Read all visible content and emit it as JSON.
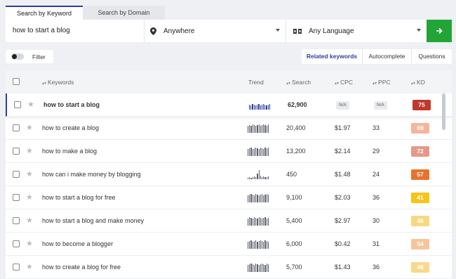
{
  "tabs": {
    "keyword": "Search by Keyword",
    "domain": "Search by Domain"
  },
  "search": {
    "query": "how to start a blog",
    "location": "Anywhere",
    "language": "Any Language"
  },
  "filter": {
    "label": "Filter"
  },
  "modes": {
    "related": "Related keywords",
    "autocomplete": "Autocomplete",
    "questions": "Questions"
  },
  "headers": {
    "keywords": "Keywords",
    "trend": "Trend",
    "search": "Search",
    "cpc": "CPC",
    "ppc": "PPC",
    "kd": "KD"
  },
  "rows": [
    {
      "keyword": "how to start a blog",
      "search": "62,900",
      "cpc": "N/A",
      "ppc": "N/A",
      "kd": "75",
      "kd_color": "#c0392b",
      "trend": [
        7,
        6,
        8,
        7,
        6,
        7,
        8,
        6,
        7,
        8,
        7,
        6,
        7,
        8
      ]
    },
    {
      "keyword": "how to create a blog",
      "search": "20,400",
      "cpc": "$1.97",
      "ppc": "33",
      "kd": "69",
      "kd_color": "#f4b69a",
      "trend": [
        10,
        11,
        10,
        12,
        11,
        10,
        11,
        12,
        10,
        11,
        12,
        11,
        10,
        12
      ]
    },
    {
      "keyword": "how to make a blog",
      "search": "13,200",
      "cpc": "$2.14",
      "ppc": "29",
      "kd": "72",
      "kd_color": "#e59a89",
      "trend": [
        10,
        11,
        12,
        10,
        11,
        12,
        11,
        10,
        12,
        11,
        10,
        12,
        11,
        12
      ]
    },
    {
      "keyword": "how can i make money by blogging",
      "search": "450",
      "cpc": "$1.48",
      "ppc": "24",
      "kd": "57",
      "kd_color": "#e8732e",
      "trend": [
        2,
        3,
        2,
        3,
        4,
        3,
        8,
        13,
        5,
        3,
        4,
        3,
        3,
        4
      ]
    },
    {
      "keyword": "how to start a blog for free",
      "search": "9,100",
      "cpc": "$2.03",
      "ppc": "36",
      "kd": "41",
      "kd_color": "#f5c518",
      "trend": [
        10,
        11,
        12,
        11,
        10,
        12,
        11,
        10,
        11,
        12,
        10,
        11,
        12,
        11
      ]
    },
    {
      "keyword": "how to start a blog and make money",
      "search": "5,400",
      "cpc": "$2.97",
      "ppc": "30",
      "kd": "46",
      "kd_color": "#f8d87f",
      "trend": [
        10,
        12,
        11,
        10,
        12,
        11,
        10,
        12,
        11,
        10,
        11,
        12,
        10,
        11
      ]
    },
    {
      "keyword": "how to become a blogger",
      "search": "6,000",
      "cpc": "$0.42",
      "ppc": "31",
      "kd": "54",
      "kd_color": "#f7c59a",
      "trend": [
        10,
        11,
        12,
        10,
        11,
        12,
        10,
        11,
        12,
        11,
        10,
        12,
        11,
        10
      ]
    },
    {
      "keyword": "how to create a blog for free",
      "search": "5,700",
      "cpc": "$1.43",
      "ppc": "36",
      "kd": "48",
      "kd_color": "#f9d98c",
      "trend": [
        10,
        11,
        12,
        11,
        10,
        12,
        11,
        10,
        11,
        12,
        11,
        10,
        12,
        11
      ]
    }
  ]
}
